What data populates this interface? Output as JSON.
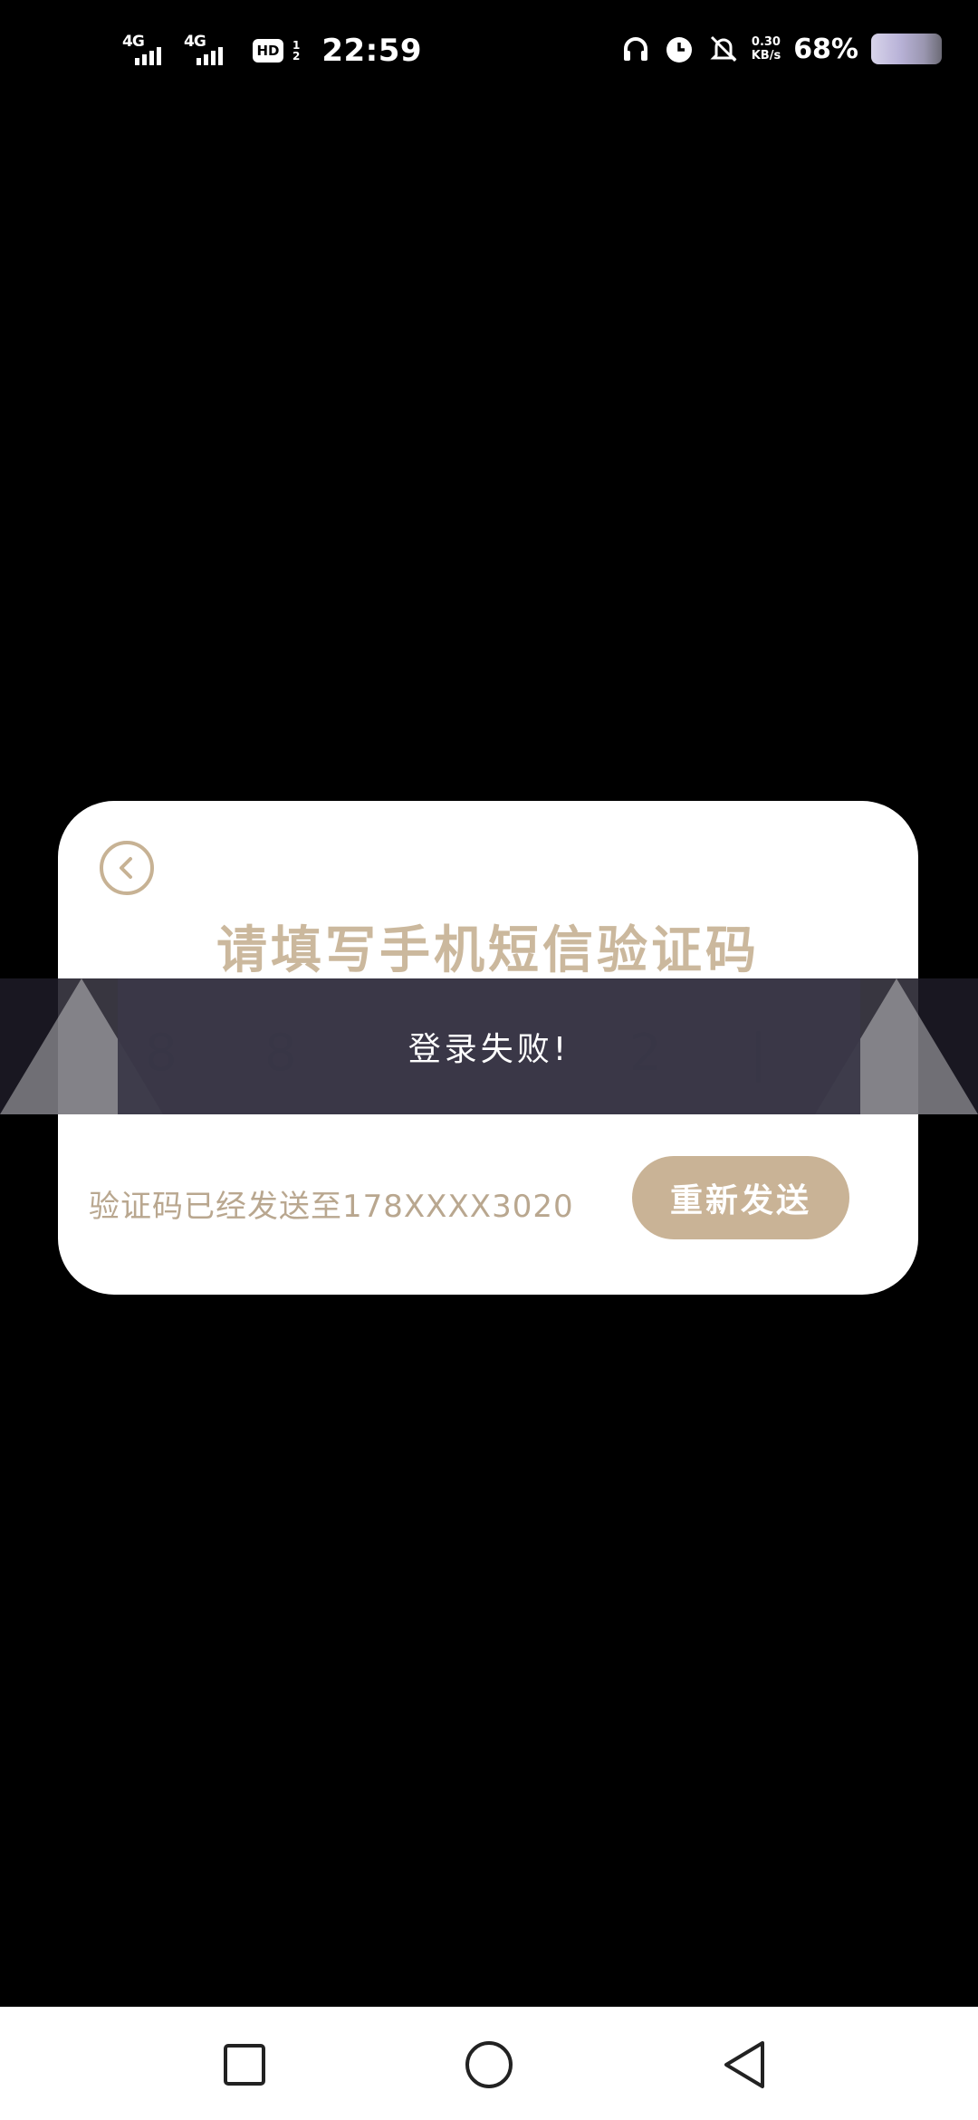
{
  "status_bar": {
    "sim1_network": "4G",
    "sim2_network": "4G",
    "hd_label": "HD",
    "hd_sub_top": "1",
    "hd_sub_bottom": "2",
    "time": "22:59",
    "net_speed_value": "0.30",
    "net_speed_unit": "KB/s",
    "battery_percent": "68%",
    "icons": [
      "headphones-icon",
      "alarm-icon",
      "mute-bell-icon"
    ]
  },
  "dialog": {
    "title": "请填写手机短信验证码",
    "code_digits": [
      "8",
      "8",
      "2",
      "|"
    ],
    "sent_text": "验证码已经发送至178XXXX3020",
    "resend_label": "重新发送",
    "accent_color": "#c9b396"
  },
  "toast": {
    "message": "登录失败!"
  },
  "nav_bar": {
    "buttons": [
      "recents-square-icon",
      "home-circle-icon",
      "back-triangle-icon"
    ]
  }
}
